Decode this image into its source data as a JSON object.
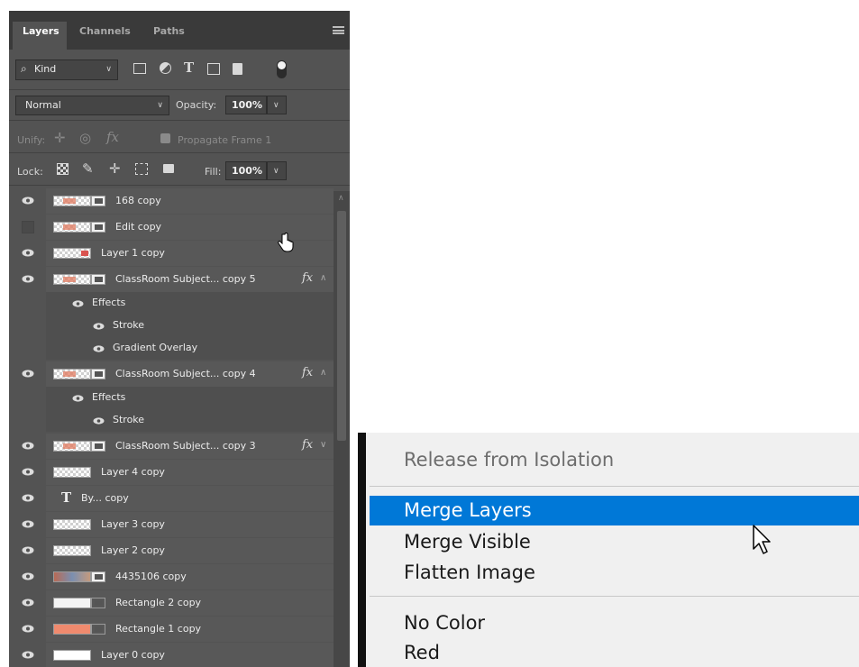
{
  "layers_panel": {
    "tabs": [
      "Layers",
      "Channels",
      "Paths"
    ],
    "filter": {
      "kind_label": "Kind"
    },
    "blend": {
      "mode": "Normal",
      "opacity_label": "Opacity:",
      "opacity_value": "100%"
    },
    "unify": {
      "label": "Unify:",
      "propagate_label": "Propagate Frame 1"
    },
    "lock": {
      "label": "Lock:",
      "fill_label": "Fill:",
      "fill_value": "100%"
    },
    "layers": [
      {
        "name": "168 copy",
        "visible": true
      },
      {
        "name": "Edit copy",
        "visible": false
      },
      {
        "name": "Layer 1 copy",
        "visible": true
      },
      {
        "name": "ClassRoom Subject... copy 5",
        "visible": true,
        "fx": "fx",
        "effects_title": "Effects",
        "effects": [
          "Stroke",
          "Gradient Overlay"
        ]
      },
      {
        "name": "ClassRoom Subject... copy 4",
        "visible": true,
        "fx": "fx",
        "effects_title": "Effects",
        "effects": [
          "Stroke"
        ]
      },
      {
        "name": "ClassRoom Subject... copy 3",
        "visible": true,
        "fx": "fx"
      },
      {
        "name": "Layer 4 copy",
        "visible": true
      },
      {
        "name": "By... copy",
        "visible": true,
        "type_icon": "T"
      },
      {
        "name": "Layer 3 copy",
        "visible": true
      },
      {
        "name": "Layer 2 copy",
        "visible": true
      },
      {
        "name": "4435106 copy",
        "visible": true
      },
      {
        "name": "Rectangle 2 copy",
        "visible": true
      },
      {
        "name": "Rectangle 1 copy",
        "visible": true,
        "thumb_color": "#f08a6e"
      },
      {
        "name": "Layer 0 copy",
        "visible": true
      }
    ]
  },
  "context_menu": {
    "items": [
      {
        "label": "Release from Isolation",
        "disabled": true
      },
      {
        "label": "Merge Layers",
        "highlighted": true
      },
      {
        "label": "Merge Visible"
      },
      {
        "label": "Flatten Image"
      },
      {
        "label": "No Color"
      },
      {
        "label": "Red"
      }
    ],
    "highlight_color": "#0078d7"
  }
}
